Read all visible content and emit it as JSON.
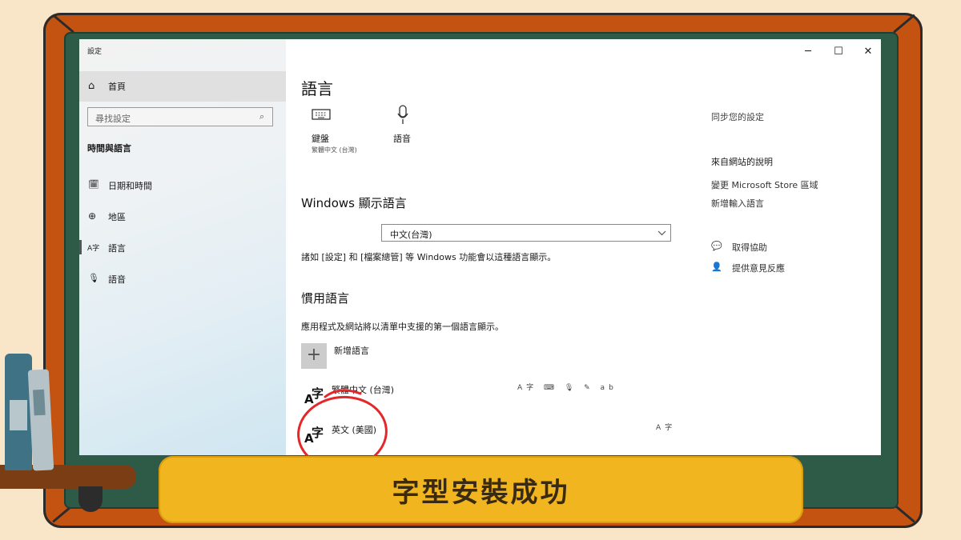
{
  "window": {
    "title": "設定",
    "controls": {
      "minimize": "─",
      "maximize": "☐",
      "close": "✕"
    }
  },
  "sidebar": {
    "home_label": "首頁",
    "search_placeholder": "尋找設定",
    "section_title": "時間與語言",
    "items": [
      {
        "icon": "calendar-clock-icon",
        "glyph": "🗓",
        "label": "日期和時間"
      },
      {
        "icon": "globe-region-icon",
        "glyph": "⊕",
        "label": "地區"
      },
      {
        "icon": "language-icon",
        "glyph": "A字",
        "label": "語言"
      },
      {
        "icon": "microphone-icon",
        "glyph": "🎙",
        "label": "語音"
      }
    ]
  },
  "main": {
    "title": "語言",
    "quick_links": [
      {
        "icon": "keyboard-icon",
        "label": "鍵盤",
        "sub": "繁體中文 (台灣)"
      },
      {
        "icon": "microphone-icon",
        "label": "語音",
        "sub": ""
      }
    ],
    "display_language": {
      "heading": "Windows 顯示語言",
      "selected": "中文(台灣)",
      "hint": "諸如 [設定] 和 [檔案總管] 等 Windows 功能會以這種語言顯示。"
    },
    "preferred": {
      "heading": "慣用語言",
      "hint": "應用程式及網站將以清單中支援的第一個語言顯示。",
      "add_label": "新增語言",
      "languages": [
        {
          "name": "繁體中文 (台灣)",
          "features": "A字 ⌨ 🎙 ✎ ab"
        },
        {
          "name": "英文 (美國)",
          "features": "A字"
        }
      ]
    }
  },
  "right_panel": {
    "sync_title": "同步您的設定",
    "web_help_title": "來自網站的說明",
    "links": [
      "變更 Microsoft Store 區域",
      "新增輸入語言"
    ],
    "get_help": "取得協助",
    "feedback": "提供意見反應"
  },
  "banner": {
    "text": "字型安裝成功"
  },
  "colors": {
    "frame": "#c45210",
    "board": "#2e5a48",
    "banner": "#f1b51f",
    "highlight_circle": "#e4272b"
  }
}
